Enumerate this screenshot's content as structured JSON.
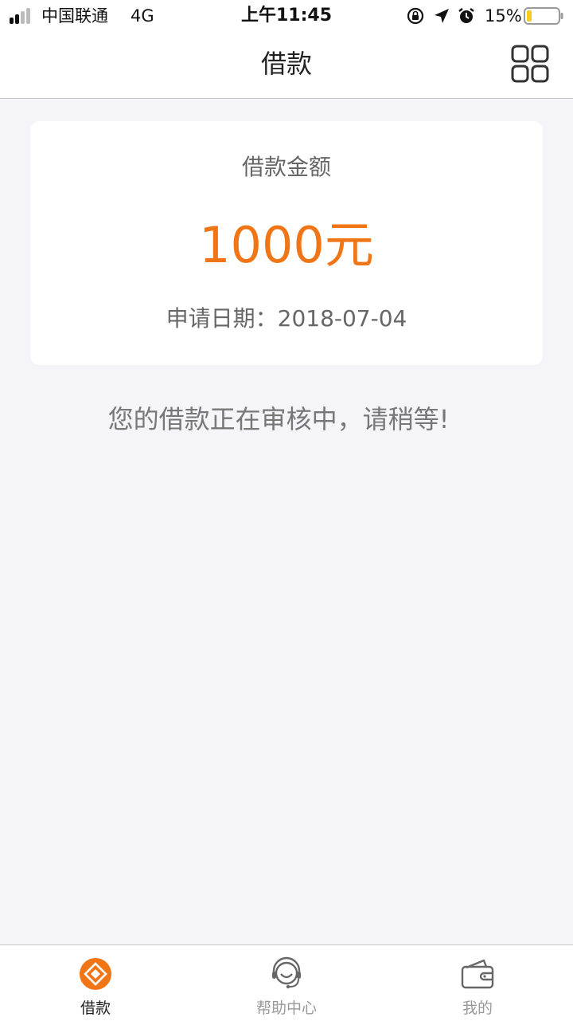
{
  "status_bar": {
    "carrier": "中国联通",
    "network": "4G",
    "time": "上午11:45",
    "battery_percent": "15%",
    "battery_level": 0.15,
    "icons": [
      "signal-icon",
      "rotation-lock-icon",
      "location-icon",
      "alarm-icon",
      "battery-icon"
    ]
  },
  "nav": {
    "title": "借款",
    "right_icon": "grid-menu-icon"
  },
  "loan_card": {
    "label": "借款金额",
    "amount": "1000元",
    "date": "申请日期：2018-07-04"
  },
  "status_message": "您的借款正在审核中，请稍等!",
  "tabs": [
    {
      "label": "借款",
      "icon": "loan-diamond-icon",
      "active": true
    },
    {
      "label": "帮助中心",
      "icon": "headset-icon",
      "active": false
    },
    {
      "label": "我的",
      "icon": "wallet-icon",
      "active": false
    }
  ],
  "colors": {
    "accent": "#f07516",
    "background": "#f4f4f9",
    "text_muted": "#777777"
  }
}
